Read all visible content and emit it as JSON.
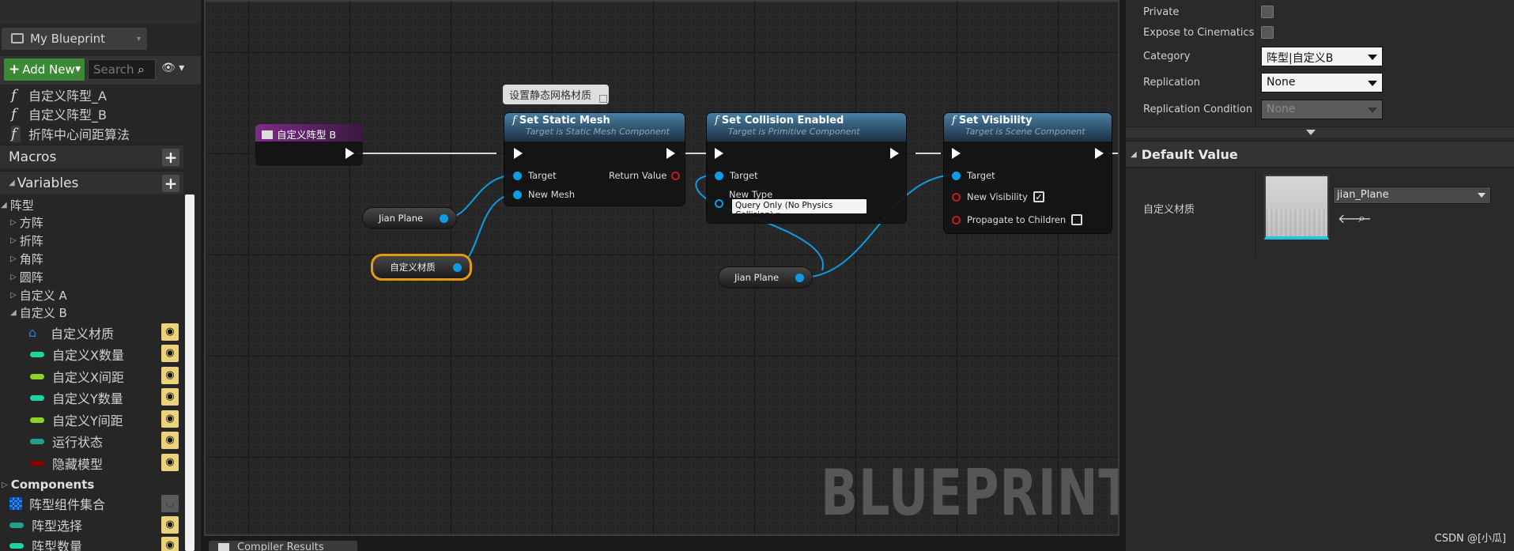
{
  "left_panel": {
    "tab_title": "My Blueprint",
    "add_new": "Add New",
    "search_placeholder": "Search",
    "functions": [
      "自定义阵型_A",
      "自定义阵型_B",
      "折阵中心间距算法"
    ],
    "macros_label": "Macros",
    "variables_label": "Variables",
    "categories": {
      "root": "阵型",
      "items": [
        "方阵",
        "折阵",
        "角阵",
        "圆阵",
        "自定义 A",
        "自定义 B"
      ]
    },
    "variables": [
      {
        "name": "自定义材质",
        "type_color": "#2e80d8",
        "icon": "material-icon"
      },
      {
        "name": "自定义X数量",
        "type_color": "#1fd4a4"
      },
      {
        "name": "自定义X间距",
        "type_color": "#8ad42a"
      },
      {
        "name": "自定义Y数量",
        "type_color": "#1fd4a4"
      },
      {
        "name": "自定义Y间距",
        "type_color": "#8ad42a"
      },
      {
        "name": "运行状态",
        "type_color": "#1f9f90"
      },
      {
        "name": "隐藏模型",
        "type_color": "#8a0000"
      }
    ],
    "components_label": "Components",
    "components": [
      "阵型组件集合",
      "阵型选择",
      "阵型数量"
    ]
  },
  "graph": {
    "comment": "设置静态网格材质",
    "event_node": "自定义阵型 B",
    "nodes": {
      "set_static_mesh": {
        "title": "Set Static Mesh",
        "subtitle": "Target is Static Mesh Component",
        "pin_target": "Target",
        "pin_new_mesh": "New Mesh",
        "pin_return": "Return Value"
      },
      "set_collision": {
        "title": "Set Collision Enabled",
        "subtitle": "Target is Primitive Component",
        "pin_target": "Target",
        "pin_new_type": "New Type",
        "new_type_value": "Query Only (No Physics Collision)"
      },
      "set_visibility": {
        "title": "Set Visibility",
        "subtitle": "Target is Scene Component",
        "pin_target": "Target",
        "pin_new_visibility": "New Visibility",
        "new_visibility_checked": true,
        "pin_propagate": "Propagate to Children",
        "propagate_checked": false
      }
    },
    "var_nodes": [
      "Jian Plane",
      "自定义材质",
      "Jian Plane"
    ],
    "watermark": "BLUEPRINT",
    "bottom_tab": "Compiler Results"
  },
  "details": {
    "private_label": "Private",
    "expose_label": "Expose to Cinematics",
    "category_label": "Category",
    "category_value": "阵型|自定义B",
    "replication_label": "Replication",
    "replication_value": "None",
    "rep_condition_label": "Replication Condition",
    "rep_condition_value": "None",
    "default_value_header": "Default Value",
    "var_label": "自定义材质",
    "asset_value": "jian_Plane"
  },
  "credit": "CSDN @[小瓜]",
  "colors": {
    "exec_wire": "#d9d9d9",
    "object_wire": "#0e9be6",
    "selection": "#e59a12",
    "add_new": "#3b8a36"
  }
}
